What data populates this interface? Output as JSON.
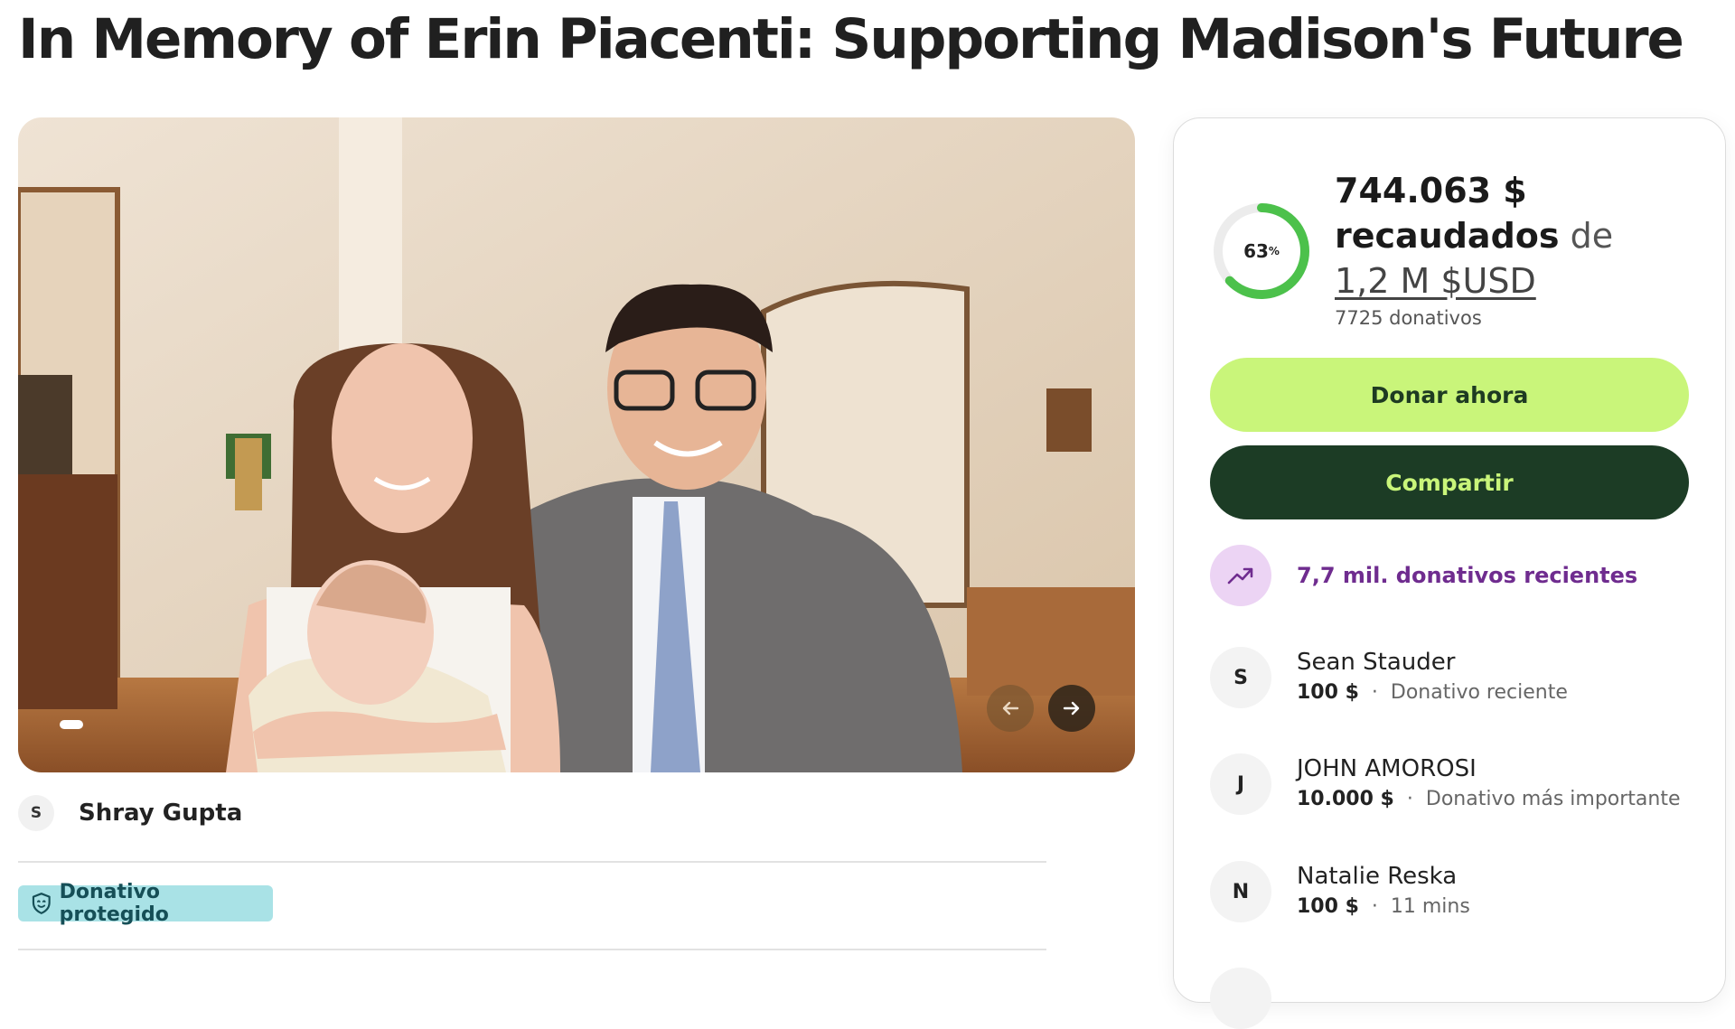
{
  "page": {
    "title": "In Memory of Erin Piacenti: Supporting Madison's Future"
  },
  "photo": {
    "prev_arrow": "←",
    "next_arrow": "→"
  },
  "organizer": {
    "initial": "S",
    "name": "Shray Gupta"
  },
  "protected_badge": {
    "label": "Donativo protegido",
    "icon": "shield-icon"
  },
  "colors": {
    "donate_button": "#c9f57a",
    "share_button": "#1c3c25",
    "progress_ring": "#4cc14b",
    "recent_accent": "#6f2c8f",
    "protected_badge": "#a9e2e6"
  },
  "fundraiser": {
    "progress_percent": 63,
    "progress_label": "63",
    "progress_symbol": "%",
    "amount_raised": "744.063 $",
    "raised_word": "recaudados",
    "of_word": "de",
    "goal": "1,2 M $USD",
    "donation_count": "7725 donativos",
    "donate_label": "Donar ahora",
    "share_label": "Compartir",
    "recent_label": "7,7 mil. donativos recientes",
    "recent_icon": "trending-up-icon"
  },
  "donors": [
    {
      "initial": "S",
      "name": "Sean Stauder",
      "amount": "100 $",
      "sep": "·",
      "note": "Donativo reciente"
    },
    {
      "initial": "J",
      "name": "JOHN AMOROSI",
      "amount": "10.000 $",
      "sep": "·",
      "note": "Donativo más importante"
    },
    {
      "initial": "N",
      "name": "Natalie Reska",
      "amount": "100 $",
      "sep": "·",
      "note": "11 mins"
    }
  ]
}
